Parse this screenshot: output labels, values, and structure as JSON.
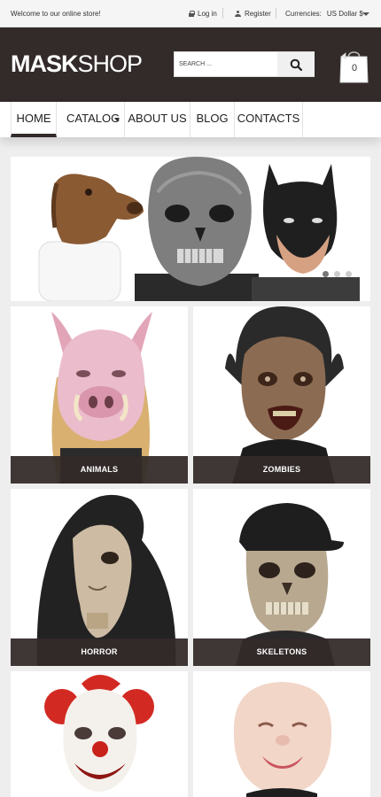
{
  "topbar": {
    "welcome": "Welcome to our online store!",
    "login": "Log in",
    "register": "Register",
    "currency_label": "Currencies:",
    "currency_value": "US Dollar $"
  },
  "header": {
    "logo_bold": "MASK",
    "logo_light": "SHOP",
    "search_placeholder": "SEARCH ...",
    "cart_count": "0"
  },
  "nav": {
    "items": [
      {
        "label": "HOME"
      },
      {
        "label": "CATALOG"
      },
      {
        "label": "ABOUT US"
      },
      {
        "label": "BLOG"
      },
      {
        "label": "CONTACTS"
      }
    ]
  },
  "slider": {
    "dot_count": 3,
    "active_dot": 0
  },
  "categories": [
    {
      "label": "ANIMALS"
    },
    {
      "label": "ZOMBIES"
    },
    {
      "label": "HORROR"
    },
    {
      "label": "SKELETONS"
    },
    {
      "label": ""
    },
    {
      "label": ""
    }
  ],
  "colors": {
    "brand_dark": "#322b2a",
    "page_bg": "#eeeeee"
  }
}
